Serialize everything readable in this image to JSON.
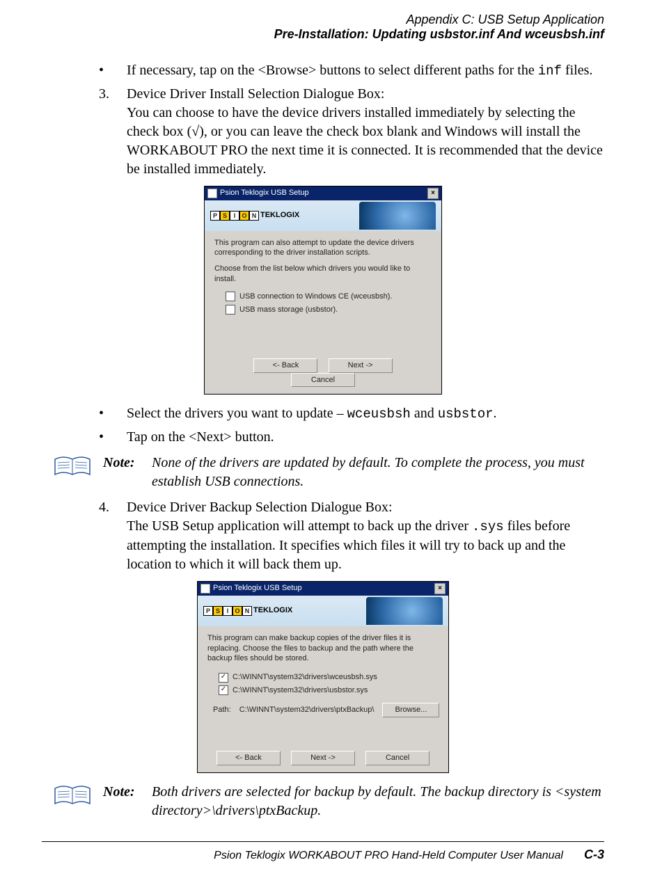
{
  "header": {
    "line1": "Appendix  C:  USB Setup Application",
    "line2": "Pre-Installation: Updating usbstor.inf And wceusbsh.inf"
  },
  "bullet1": {
    "mark": "•",
    "text_a": "If necessary, tap on the <Browse> buttons to select different paths for the ",
    "code": "inf",
    "text_b": " files."
  },
  "step3": {
    "mark": "3.",
    "title": "Device Driver Install Selection Dialogue Box:",
    "body": "You can choose to have the device drivers installed immediately by selecting the check box (√), or you can leave the check box blank and Windows will install the WORKABOUT PRO the next time it is connected. It is recommended that the device be installed immediately."
  },
  "dialog1": {
    "title": "Psion Teklogix USB Setup",
    "logo_text": "TEKLOGIX",
    "logo_letters": [
      "P",
      "S",
      "I",
      "O",
      "N"
    ],
    "para1": "This program can also attempt to update the device drivers corresponding to the driver installation scripts.",
    "para2": "Choose from the list below which drivers you would like to install.",
    "chk1": "USB connection to Windows CE (wceusbsh).",
    "chk2": "USB mass storage (usbstor).",
    "btn_back": "<- Back",
    "btn_next": "Next ->",
    "btn_cancel": "Cancel"
  },
  "bullet2": {
    "mark": "•",
    "text_a": "Select the drivers you want to update – ",
    "code1": "wceusbsh",
    "mid": " and ",
    "code2": "usbstor",
    "end": "."
  },
  "bullet3": {
    "mark": "•",
    "text": "Tap on the <Next> button."
  },
  "note1": {
    "label": "Note:",
    "text": "None of the drivers are updated by default. To complete the process, you must establish USB connections."
  },
  "step4": {
    "mark": "4.",
    "title": "Device Driver Backup Selection Dialogue Box:",
    "body_a": "The USB Setup application will attempt to back up the driver ",
    "code": ".sys",
    "body_b": " files before attempting the installation. It specifies which files it will try to back up and the location to which it will back them up."
  },
  "dialog2": {
    "title": "Psion Teklogix USB Setup",
    "logo_text": "TEKLOGIX",
    "logo_letters": [
      "P",
      "S",
      "I",
      "O",
      "N"
    ],
    "para": "This program can make backup copies of the driver files it is replacing. Choose the files to backup and the path where the backup files should be stored.",
    "chk1": "C:\\WINNT\\system32\\drivers\\wceusbsh.sys",
    "chk2": "C:\\WINNT\\system32\\drivers\\usbstor.sys",
    "path_label": "Path:",
    "path_value": "C:\\WINNT\\system32\\drivers\\ptxBackup\\",
    "btn_browse": "Browse...",
    "btn_back": "<- Back",
    "btn_next": "Next ->",
    "btn_cancel": "Cancel"
  },
  "note2": {
    "label": "Note:",
    "text": "Both drivers are selected for backup by default. The backup directory is <system directory>\\drivers\\ptxBackup."
  },
  "footer": {
    "title": "Psion Teklogix WORKABOUT PRO Hand-Held Computer User Manual",
    "page": "C-3"
  }
}
